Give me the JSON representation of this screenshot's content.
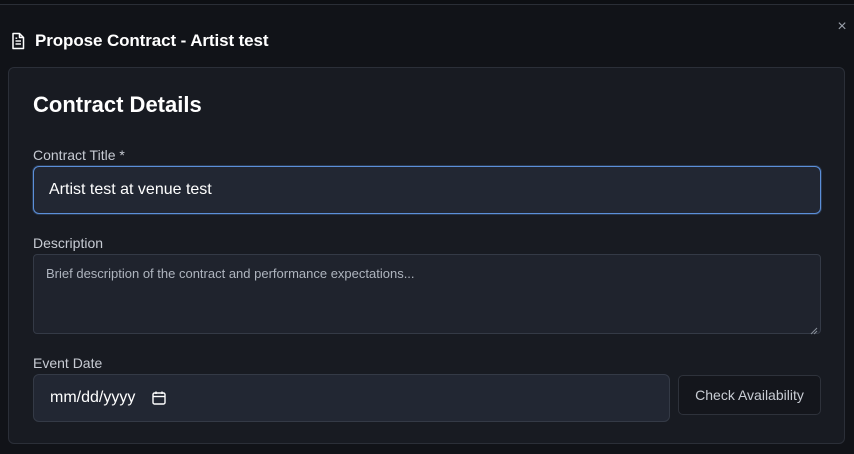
{
  "dialog": {
    "title": "Propose Contract - Artist test",
    "close_glyph": "×"
  },
  "section": {
    "title": "Contract Details"
  },
  "fields": {
    "contract_title": {
      "label": "Contract Title *",
      "value": "Artist test at venue test"
    },
    "description": {
      "label": "Description",
      "placeholder": "Brief description of the contract and performance expectations..."
    },
    "event_date": {
      "label": "Event Date",
      "placeholder": "mm/dd/yyyy"
    }
  },
  "buttons": {
    "check_availability": "Check Availability"
  },
  "icons": {
    "dialog_icon": "document-icon",
    "close": "close-icon",
    "date_picker": "calendar-icon"
  },
  "colors": {
    "background": "#111318",
    "card": "#181b22",
    "input": "#222733",
    "focus_border": "#5b8fd9"
  }
}
